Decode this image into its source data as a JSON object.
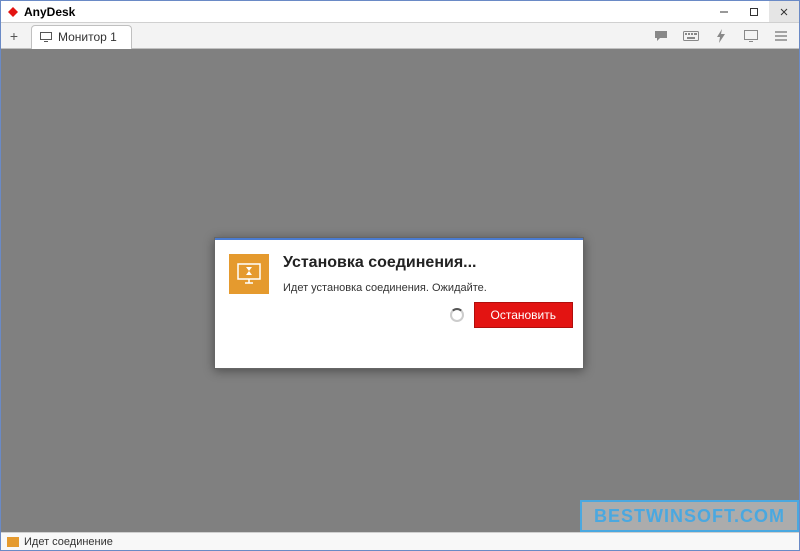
{
  "app": {
    "title": "AnyDesk"
  },
  "tabs": {
    "tab1_label": "Монитор 1"
  },
  "dialog": {
    "title": "Установка соединения...",
    "message": "Идет установка соединения. Ожидайте.",
    "stop_label": "Остановить"
  },
  "statusbar": {
    "text": "Идет соединение"
  },
  "watermark": {
    "text": "BESTWINSOFT.COM"
  },
  "colors": {
    "accent_red": "#e31412",
    "accent_orange": "#e59a2e",
    "dialog_topline": "#4a7bd0"
  }
}
